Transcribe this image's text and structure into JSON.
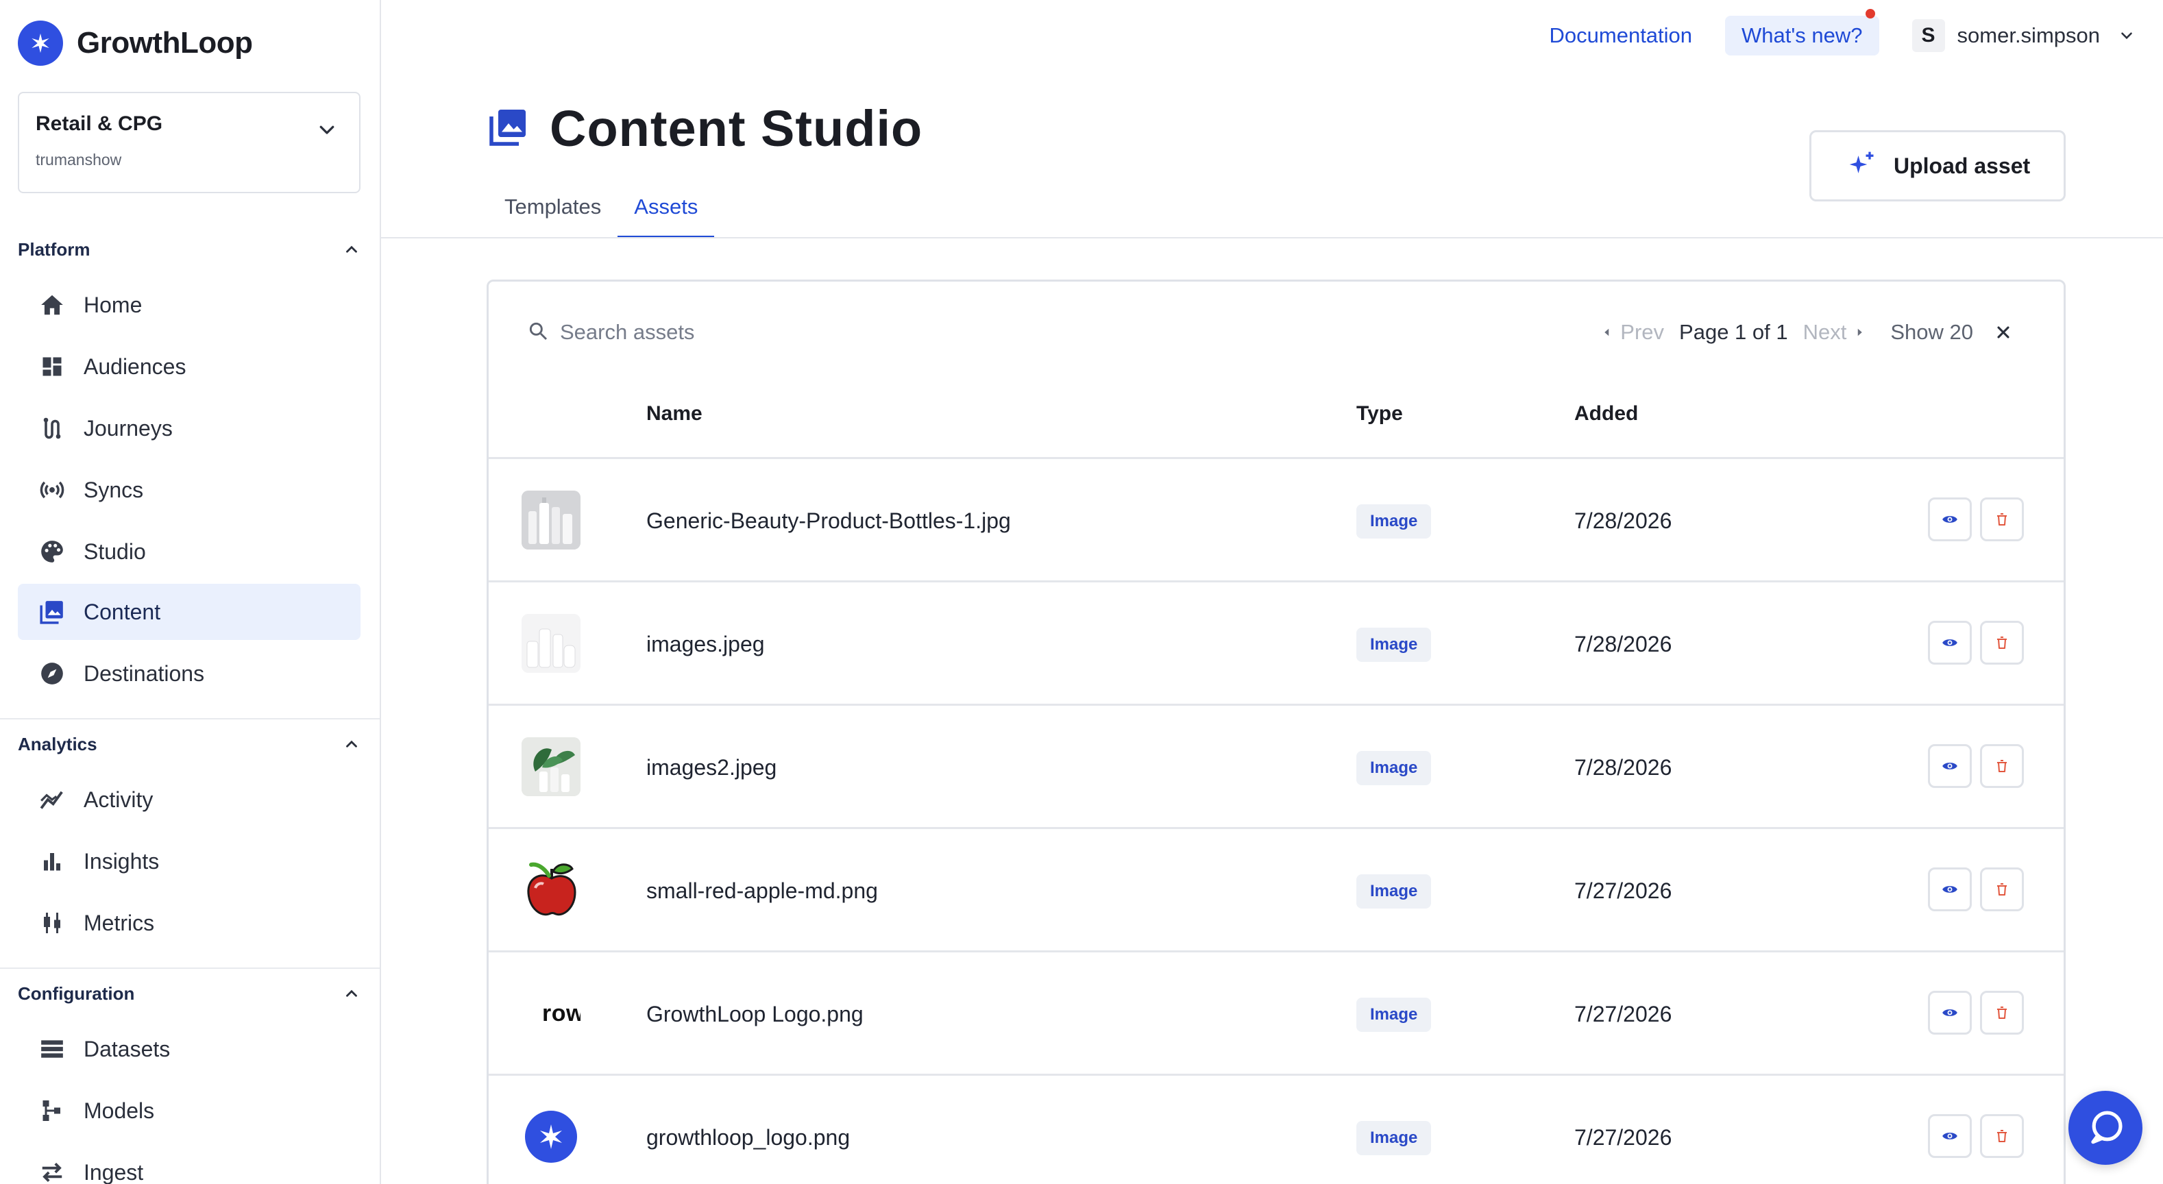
{
  "brand": {
    "name": "GrowthLoop",
    "accent": "#2f4fe0"
  },
  "workspace": {
    "name": "Retail & CPG",
    "sub": "trumanshow"
  },
  "sidebar": {
    "sections": [
      {
        "title": "Platform",
        "items": [
          {
            "label": "Home",
            "icon": "home-icon"
          },
          {
            "label": "Audiences",
            "icon": "dashboard-icon"
          },
          {
            "label": "Journeys",
            "icon": "route-icon"
          },
          {
            "label": "Syncs",
            "icon": "broadcast-icon"
          },
          {
            "label": "Studio",
            "icon": "palette-icon"
          },
          {
            "label": "Content",
            "icon": "image-icon",
            "active": true
          },
          {
            "label": "Destinations",
            "icon": "compass-icon"
          }
        ]
      },
      {
        "title": "Analytics",
        "items": [
          {
            "label": "Activity",
            "icon": "trend-icon"
          },
          {
            "label": "Insights",
            "icon": "bar-chart-icon"
          },
          {
            "label": "Metrics",
            "icon": "candlestick-icon"
          }
        ]
      },
      {
        "title": "Configuration",
        "items": [
          {
            "label": "Datasets",
            "icon": "list-icon"
          },
          {
            "label": "Models",
            "icon": "tree-icon"
          },
          {
            "label": "Ingest",
            "icon": "swap-icon"
          }
        ]
      }
    ]
  },
  "header": {
    "documentation": "Documentation",
    "whats_new": "What's new?",
    "user_initial": "S",
    "user_name": "somer.simpson"
  },
  "page": {
    "title": "Content Studio",
    "upload_label": "Upload asset",
    "tabs": [
      {
        "label": "Templates"
      },
      {
        "label": "Assets",
        "active": true
      }
    ]
  },
  "table": {
    "search_placeholder": "Search assets",
    "pager": {
      "prev": "Prev",
      "page": "Page 1 of 1",
      "next": "Next",
      "show": "Show 20"
    },
    "columns": {
      "name": "Name",
      "type": "Type",
      "added": "Added"
    },
    "rows": [
      {
        "name": "Generic-Beauty-Product-Bottles-1.jpg",
        "type": "Image",
        "added": "7/28/2026",
        "thumb": "bottles"
      },
      {
        "name": "images.jpeg",
        "type": "Image",
        "added": "7/28/2026",
        "thumb": "bottles-white"
      },
      {
        "name": "images2.jpeg",
        "type": "Image",
        "added": "7/28/2026",
        "thumb": "plant-bottles"
      },
      {
        "name": "small-red-apple-md.png",
        "type": "Image",
        "added": "7/27/2026",
        "thumb": "apple"
      },
      {
        "name": "GrowthLoop Logo.png",
        "type": "Image",
        "added": "7/27/2026",
        "thumb": "logo-text",
        "thumb_text": "rowtl"
      },
      {
        "name": "growthloop_logo.png",
        "type": "Image",
        "added": "7/27/2026",
        "thumb": "logo-mark"
      }
    ]
  }
}
